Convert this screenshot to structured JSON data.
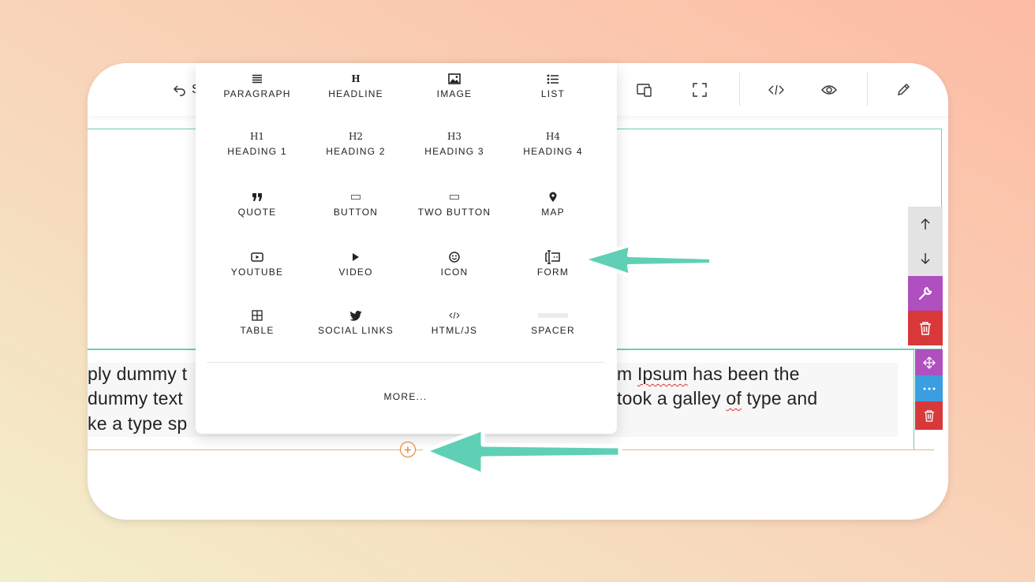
{
  "toolbar": {
    "undo_label": "S",
    "icons": [
      "undo-icon",
      "responsive-icon",
      "fullscreen-icon",
      "code-icon",
      "preview-icon",
      "edit-icon"
    ]
  },
  "content": {
    "line1_left": "ply dummy t",
    "line1_right_a": "m ",
    "line1_right_b": "Ipsum",
    "line1_right_c": " has been the",
    "line2_left": " dummy text",
    "line2_right_a": "took a galley ",
    "line2_right_b": "of",
    "line2_right_c": " type and",
    "line3_left": "ke a type sp"
  },
  "menu": {
    "items": [
      {
        "label": "PARAGRAPH",
        "icon": "paragraph-icon"
      },
      {
        "label": "HEADLINE",
        "icon": "headline-icon",
        "glyph": "H"
      },
      {
        "label": "IMAGE",
        "icon": "image-icon"
      },
      {
        "label": "LIST",
        "icon": "list-icon"
      },
      {
        "label": "HEADING 1",
        "icon": "heading1-icon",
        "glyph": "H1"
      },
      {
        "label": "HEADING 2",
        "icon": "heading2-icon",
        "glyph": "H2"
      },
      {
        "label": "HEADING 3",
        "icon": "heading3-icon",
        "glyph": "H3"
      },
      {
        "label": "HEADING 4",
        "icon": "heading4-icon",
        "glyph": "H4"
      },
      {
        "label": "QUOTE",
        "icon": "quote-icon"
      },
      {
        "label": "BUTTON",
        "icon": "button-icon"
      },
      {
        "label": "TWO BUTTON",
        "icon": "two-button-icon"
      },
      {
        "label": "MAP",
        "icon": "map-pin-icon"
      },
      {
        "label": "YOUTUBE",
        "icon": "youtube-icon"
      },
      {
        "label": "VIDEO",
        "icon": "play-icon"
      },
      {
        "label": "ICON",
        "icon": "smiley-icon"
      },
      {
        "label": "FORM",
        "icon": "form-icon"
      },
      {
        "label": "TABLE",
        "icon": "table-icon"
      },
      {
        "label": "SOCIAL LINKS",
        "icon": "twitter-icon"
      },
      {
        "label": "HTML/JS",
        "icon": "code-icon"
      },
      {
        "label": "SPACER",
        "icon": "spacer-icon"
      }
    ],
    "more_label": "MORE..."
  },
  "colors": {
    "accent_green": "#5fd0b5",
    "section_border": "#6fcfa8",
    "purple": "#b04fc0",
    "red": "#d9383a",
    "blue": "#3a9ee0",
    "orange": "#e57a1f"
  }
}
